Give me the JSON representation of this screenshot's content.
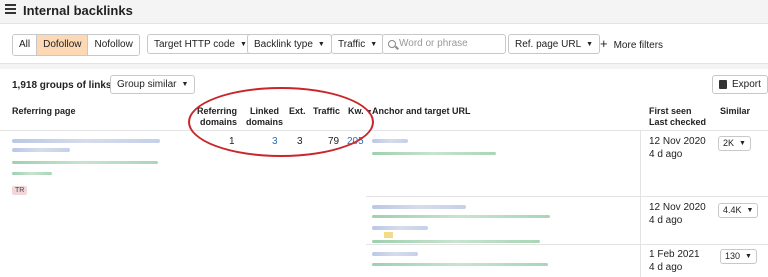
{
  "header": {
    "title": "Internal backlinks"
  },
  "filters": {
    "segment": [
      "All",
      "Dofollow",
      "Nofollow"
    ],
    "active_segment": "Dofollow",
    "target_http_code": "Target HTTP code",
    "backlink_type": "Backlink type",
    "traffic": "Traffic",
    "search_placeholder": "Word or phrase",
    "ref_page_url": "Ref. page URL",
    "more_filters": "More filters"
  },
  "toolbar": {
    "groups_label": "1,918 groups of links",
    "group_similar": "Group similar",
    "export": "Export"
  },
  "columns": {
    "referring_page": "Referring page",
    "referring_domains": [
      "Referring",
      "domains"
    ],
    "linked_domains": [
      "Linked",
      "domains"
    ],
    "ext": "Ext.",
    "traffic": "Traffic",
    "kw": "Kw.",
    "anchor": "Anchor and target URL",
    "first_seen": [
      "First seen",
      "Last checked"
    ],
    "similar": "Similar"
  },
  "rows": [
    {
      "referring_domains": "1",
      "linked_domains": "3",
      "ext": "3",
      "traffic": "79",
      "kw": "205",
      "first_seen": "12 Nov 2020",
      "last_checked": "4 d ago",
      "similar": "2K",
      "badge": "TR"
    },
    {
      "first_seen": "12 Nov 2020",
      "last_checked": "4 d ago",
      "similar": "4.4K"
    },
    {
      "first_seen": "1 Feb 2021",
      "last_checked": "4 d ago",
      "similar": "130"
    }
  ],
  "icons": {
    "menu": "hamburger-icon",
    "search": "search-icon",
    "plus": "plus-icon",
    "export": "export-icon",
    "caret": "caret-down-icon"
  },
  "colors": {
    "active_segment": "#fcd8b4",
    "link": "#2a6ebb",
    "annotation": "#c9262b"
  }
}
